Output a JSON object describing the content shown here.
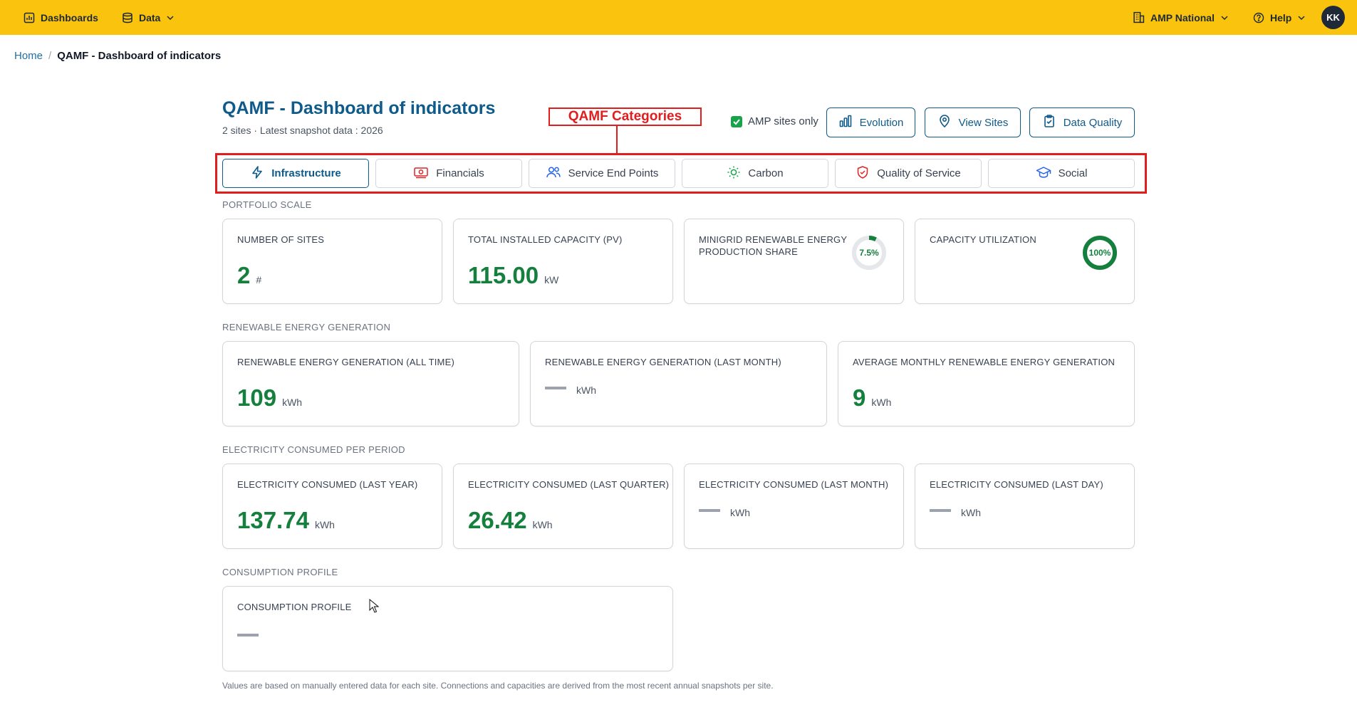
{
  "topbar": {
    "dashboards_label": "Dashboards",
    "data_label": "Data",
    "org_label": "AMP National",
    "help_label": "Help",
    "avatar_initials": "KK",
    "background_color": "#f9c30e"
  },
  "breadcrumb": {
    "home": "Home",
    "separator": "/",
    "current": "QAMF - Dashboard of indicators"
  },
  "page": {
    "title": "QAMF - Dashboard of indicators",
    "subtitle": "2 sites · Latest snapshot data : 2026",
    "annotation_label": "QAMF Categories"
  },
  "header_actions": {
    "amp_sites_only_label": "AMP sites only",
    "amp_sites_only_checked": true,
    "evolution_label": "Evolution",
    "view_sites_label": "View Sites",
    "data_quality_label": "Data Quality"
  },
  "tabs": [
    {
      "label": "Infrastructure",
      "icon": "bolt-icon",
      "active": true
    },
    {
      "label": "Financials",
      "icon": "money-icon",
      "active": false
    },
    {
      "label": "Service End Points",
      "icon": "users-icon",
      "active": false
    },
    {
      "label": "Carbon",
      "icon": "sun-icon",
      "active": false
    },
    {
      "label": "Quality of Service",
      "icon": "shield-check-icon",
      "active": false
    },
    {
      "label": "Social",
      "icon": "graduation-cap-icon",
      "active": false
    }
  ],
  "sections": {
    "portfolio_scale": "PORTFOLIO SCALE",
    "renewable_generation": "RENEWABLE ENERGY GENERATION",
    "electricity_consumed": "ELECTRICITY CONSUMED PER PERIOD",
    "consumption_profile": "CONSUMPTION PROFILE"
  },
  "portfolio_cards": {
    "sites": {
      "title": "NUMBER OF SITES",
      "value": "2",
      "unit": "#"
    },
    "capacity": {
      "title": "TOTAL INSTALLED CAPACITY (PV)",
      "value": "115.00",
      "unit": "kW"
    },
    "share": {
      "title_line1": "MINIGRID RENEWABLE ENERGY",
      "title_line2": "PRODUCTION SHARE",
      "value": "7.5%",
      "fraction": 0.075
    },
    "utilization": {
      "title": "CAPACITY UTILIZATION",
      "value": "100%",
      "fraction": 1.0
    }
  },
  "generation_cards": {
    "all_time": {
      "title": "RENEWABLE ENERGY GENERATION (ALL TIME)",
      "value": "109",
      "unit": "kWh"
    },
    "last_month": {
      "title": "RENEWABLE ENERGY GENERATION (LAST MONTH)",
      "value": "",
      "unit": "kWh"
    },
    "average_monthly": {
      "title": "AVERAGE MONTHLY RENEWABLE ENERGY GENERATION",
      "value": "9",
      "unit": "kWh"
    }
  },
  "consumed_cards": {
    "last_year": {
      "title": "ELECTRICITY CONSUMED (LAST YEAR)",
      "value": "137.74",
      "unit": "kWh"
    },
    "last_quarter": {
      "title": "ELECTRICITY CONSUMED (LAST QUARTER)",
      "value": "26.42",
      "unit": "kWh"
    },
    "last_month": {
      "title": "ELECTRICITY CONSUMED (LAST MONTH)",
      "value": "",
      "unit": "kWh"
    },
    "last_day": {
      "title": "ELECTRICITY CONSUMED (LAST DAY)",
      "value": "",
      "unit": "kWh"
    }
  },
  "profile_card": {
    "title": "CONSUMPTION PROFILE",
    "value": ""
  },
  "footnote": "Values are based on manually entered data for each site. Connections and capacities are derived from the most recent annual snapshots per site.",
  "colors": {
    "accent": "#0e5a8a",
    "positive": "#15803d",
    "annotation": "#e11d1d"
  }
}
